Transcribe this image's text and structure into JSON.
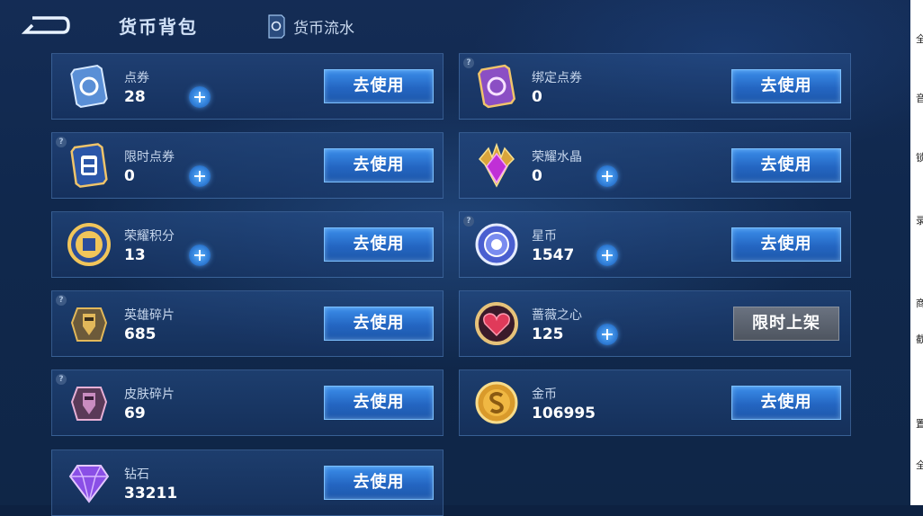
{
  "header": {
    "title": "货币背包",
    "flow_label": "货币流水"
  },
  "help_mark": "?",
  "cards": [
    {
      "name": "点券",
      "value": "28",
      "button": "去使用",
      "icon": "ticket-icon",
      "plus": true,
      "help": false
    },
    {
      "name": "绑定点券",
      "value": "0",
      "button": "去使用",
      "icon": "bound-ticket-icon",
      "plus": false,
      "help": true
    },
    {
      "name": "限时点券",
      "value": "0",
      "button": "去使用",
      "icon": "limited-ticket-icon",
      "plus": true,
      "help": true
    },
    {
      "name": "荣耀水晶",
      "value": "0",
      "button": "去使用",
      "icon": "glory-crystal-icon",
      "plus": true,
      "help": false
    },
    {
      "name": "荣耀积分",
      "value": "13",
      "button": "去使用",
      "icon": "glory-points-icon",
      "plus": true,
      "help": false
    },
    {
      "name": "星币",
      "value": "1547",
      "button": "去使用",
      "icon": "star-coin-icon",
      "plus": true,
      "help": true
    },
    {
      "name": "英雄碎片",
      "value": "685",
      "button": "去使用",
      "icon": "hero-fragment-icon",
      "plus": false,
      "help": true
    },
    {
      "name": "蔷薇之心",
      "value": "125",
      "button": "限时上架",
      "icon": "rose-heart-icon",
      "plus": true,
      "help": false
    },
    {
      "name": "皮肤碎片",
      "value": "69",
      "button": "去使用",
      "icon": "skin-fragment-icon",
      "plus": false,
      "help": true
    },
    {
      "name": "金币",
      "value": "106995",
      "button": "去使用",
      "icon": "gold-coin-icon",
      "plus": false,
      "help": false
    },
    {
      "name": "钻石",
      "value": "33211",
      "button": "去使用",
      "icon": "diamond-icon",
      "plus": false,
      "help": false
    }
  ],
  "side_glyphs": [
    "全",
    "音",
    "锁",
    "录",
    "商",
    "截",
    "置",
    "全"
  ]
}
